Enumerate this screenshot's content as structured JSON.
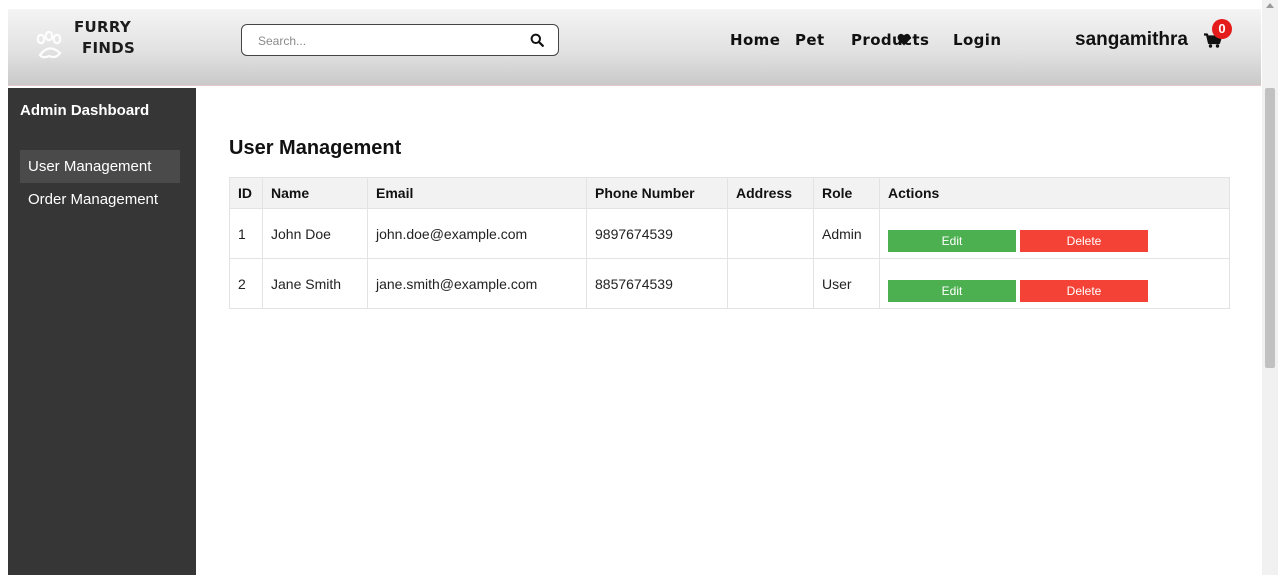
{
  "header": {
    "logo_line1": "FURRY",
    "logo_line2": "FINDS",
    "search_placeholder": "Search...",
    "nav": {
      "home": "Home",
      "pet": "Pet",
      "products": "Products",
      "login": "Login"
    },
    "username": "sangamithra",
    "cart_count": "0"
  },
  "icons": {
    "logo": "paw-icon",
    "search": "search-icon",
    "wishlist": "heart-icon",
    "cart": "cart-icon"
  },
  "sidebar": {
    "title": "Admin Dashboard",
    "items": [
      {
        "label": "User Management",
        "active": true
      },
      {
        "label": "Order Management",
        "active": false
      }
    ]
  },
  "main": {
    "title": "User Management",
    "columns": [
      "ID",
      "Name",
      "Email",
      "Phone Number",
      "Address",
      "Role",
      "Actions"
    ],
    "rows": [
      {
        "id": "1",
        "name": "John Doe",
        "email": "john.doe@example.com",
        "phone": "9897674539",
        "address": "",
        "role": "Admin"
      },
      {
        "id": "2",
        "name": "Jane Smith",
        "email": "jane.smith@example.com",
        "phone": "8857674539",
        "address": "",
        "role": "User"
      }
    ],
    "edit_label": "Edit",
    "delete_label": "Delete"
  },
  "colors": {
    "sidebar_bg": "#363636",
    "edit_button": "#4caf50",
    "delete_button": "#f44336",
    "cart_badge": "#e51b1b"
  }
}
